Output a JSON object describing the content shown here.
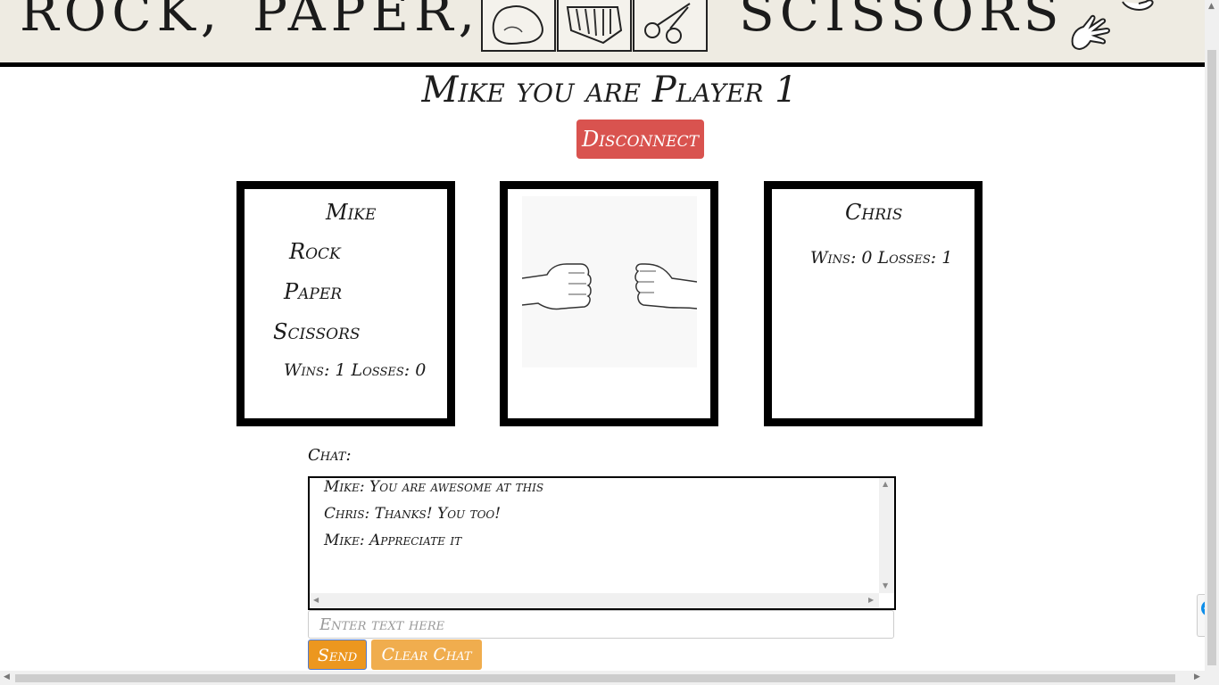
{
  "header": {
    "logo_words": [
      "ROCK,",
      "PAPER,",
      "SCISSORS"
    ],
    "logo_icons": [
      "rock-icon",
      "paper-icon",
      "scissors-icon"
    ]
  },
  "page_title": "Mike you are Player 1",
  "disconnect_label": "Disconnect",
  "player1": {
    "name": "Mike",
    "choices": [
      "Rock",
      "Paper",
      "Scissors"
    ],
    "score": "Wins: 1 Losses: 0"
  },
  "arena": {
    "image": "two-fists-icon"
  },
  "player2": {
    "name": "Chris",
    "score": "Wins: 0 Losses: 1"
  },
  "chat": {
    "label": "Chat:",
    "messages": [
      "Mike: You are awesome at this",
      "Chris: Thanks! You too!",
      "Mike: Appreciate it"
    ],
    "input_placeholder": "Enter text here",
    "send_label": "Send",
    "clear_label": "Clear Chat"
  },
  "colors": {
    "disconnect": "#d9534f",
    "send": "#ec971f",
    "clear": "#f0ad4e",
    "header_bg": "#eeebe2"
  }
}
